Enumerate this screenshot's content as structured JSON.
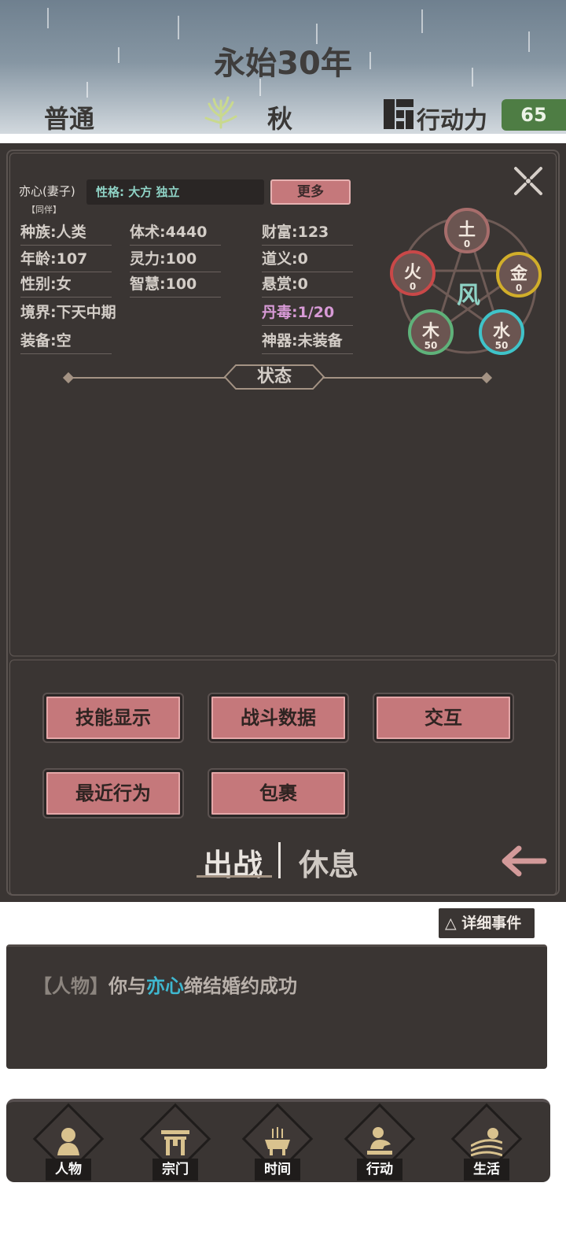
{
  "header": {
    "year": "永始30年",
    "mode": "普通",
    "season": "秋",
    "action_points_label": "行动力",
    "action_points_value": "65"
  },
  "character": {
    "name": "亦心(妻子)",
    "tag": "【同伴】",
    "trait": "性格: 大方 独立",
    "more_label": "更多",
    "stats": {
      "race": "种族:人类",
      "body": "体术:4440",
      "wealth": "财富:123",
      "age": "年龄:107",
      "spirit": "灵力:100",
      "righteousness": "道义:0",
      "gender": "性别:女",
      "wisdom": "智慧:100",
      "bounty": "悬赏:0",
      "realm": "境界:下天中期",
      "pill_poison": "丹毒:1/20",
      "equipment": "装备:空",
      "artifact": "神器:未装备"
    },
    "status_title": "状态"
  },
  "elements": {
    "earth": {
      "glyph": "土",
      "value": "0",
      "color": "#a76d6b"
    },
    "fire": {
      "glyph": "火",
      "value": "0",
      "color": "#c94848"
    },
    "metal": {
      "glyph": "金",
      "value": "0",
      "color": "#d1ae2a"
    },
    "wood": {
      "glyph": "木",
      "value": "50",
      "color": "#5fb27a"
    },
    "water": {
      "glyph": "水",
      "value": "50",
      "color": "#3fc3c9"
    },
    "center": "风"
  },
  "actions": {
    "skills": "技能显示",
    "battle_data": "战斗数据",
    "interact": "交互",
    "recent": "最近行为",
    "bag": "包裹"
  },
  "deploy": {
    "battle": "出战",
    "rest": "休息"
  },
  "events": {
    "detail_label": "△ 详细事件",
    "line_category": "【人物】",
    "line_pre": "你与",
    "line_name": "亦心",
    "line_post": "缔结婚约成功"
  },
  "nav": {
    "character": "人物",
    "sect": "宗门",
    "time": "时间",
    "action": "行动",
    "life": "生活"
  }
}
